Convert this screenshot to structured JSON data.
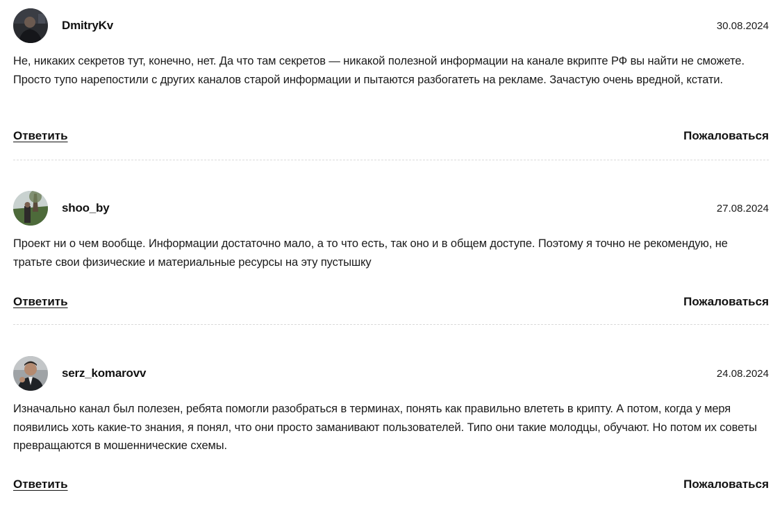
{
  "comments": [
    {
      "author": "DmitryKv",
      "date": "30.08.2024",
      "text": "Не, никаких секретов тут, конечно, нет. Да что там секретов — никакой полезной информации на канале вкрипте РФ вы найти не сможете. Просто тупо нарепостили с других каналов старой информации и пытаются разбогатеть на рекламе. Зачастую очень вредной, кстати.",
      "reply_label": "Ответить",
      "report_label": "Пожаловаться"
    },
    {
      "author": "shoo_by",
      "date": "27.08.2024",
      "text": "Проект ни о чем вообще. Информации достаточно мало, а то что есть, так оно и в общем доступе. Поэтому я точно не рекомендую, не тратьте свои физические и материальные ресурсы на эту пустышку",
      "reply_label": "Ответить",
      "report_label": "Пожаловаться"
    },
    {
      "author": "serz_komarovv",
      "date": "24.08.2024",
      "text": "Изначально канал был полезен, ребята помогли разобраться в терминах, понять как правильно влететь в крипту. А потом, когда у меря появились хоть какие-то знания, я понял, что они просто заманивают пользователей. Типо они такие молодцы, обучают. Но потом их советы превращаются в мошеннические схемы.",
      "reply_label": "Ответить",
      "report_label": "Пожаловаться"
    }
  ]
}
